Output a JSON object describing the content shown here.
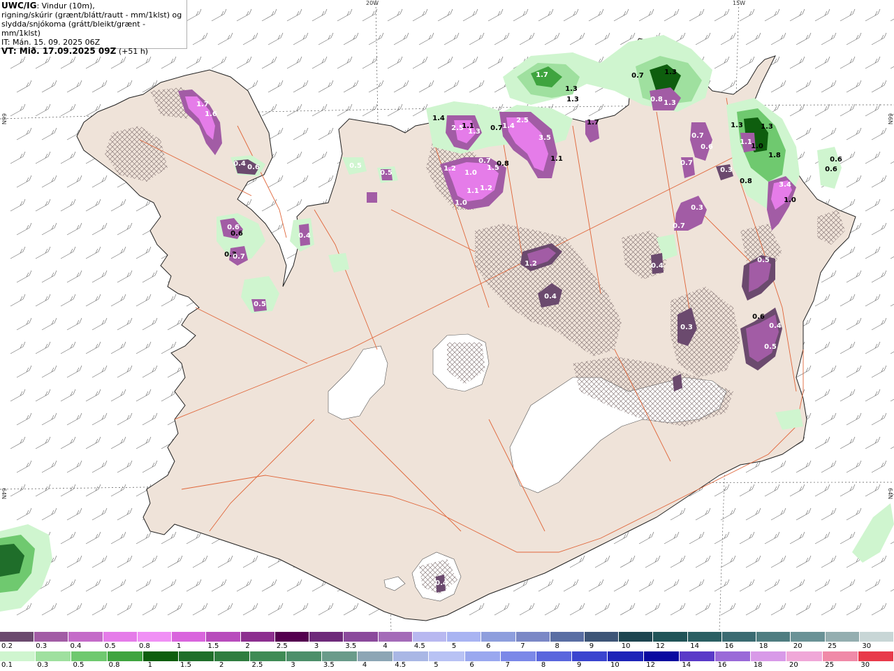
{
  "title": {
    "model": "UWC/IG",
    "desc_1": ": Vindur (10m),",
    "desc_2": "rigning/skúrir (grænt/blátt/rautt - mm/1klst) og",
    "desc_3": "slydda/snjókoma (grátt/bleikt/grænt - mm/1klst)",
    "it": "IT: Mán. 15. 09. 2025 06Z",
    "vt_label": "VT: Mið. 17.09.2025 09Z",
    "vt_offset": "(+51 h)"
  },
  "grid_labels": {
    "lon_20w": "20W",
    "lon_15w": "15W",
    "lat_66n_left": "66N",
    "lat_66n_right": "66N",
    "lat_64n_left": "64N",
    "lat_64n_right": "64N"
  },
  "value_labels": [
    {
      "t": "1.7",
      "c": "w"
    },
    {
      "t": "1.6",
      "c": "w"
    },
    {
      "t": "0.4",
      "c": "w"
    },
    {
      "t": "0.6",
      "c": "w"
    },
    {
      "t": "0.6",
      "c": "w"
    },
    {
      "t": "0.6",
      "c": "k"
    },
    {
      "t": "0.3",
      "c": "k"
    },
    {
      "t": "0.7",
      "c": "w"
    },
    {
      "t": "0.5",
      "c": "w"
    },
    {
      "t": "0.4",
      "c": "w"
    },
    {
      "t": "0.5",
      "c": "w"
    },
    {
      "t": "0.5",
      "c": "w"
    },
    {
      "t": "1.4",
      "c": "k"
    },
    {
      "t": "2.5",
      "c": "w"
    },
    {
      "t": "1.1",
      "c": "k"
    },
    {
      "t": "1.3",
      "c": "w"
    },
    {
      "t": "0.7",
      "c": "k"
    },
    {
      "t": "1.4",
      "c": "w"
    },
    {
      "t": "2.5",
      "c": "w"
    },
    {
      "t": "3.5",
      "c": "w"
    },
    {
      "t": "1.2",
      "c": "w"
    },
    {
      "t": "1.0",
      "c": "w"
    },
    {
      "t": "0.7",
      "c": "w"
    },
    {
      "t": "1.5",
      "c": "w"
    },
    {
      "t": "1.1",
      "c": "w"
    },
    {
      "t": "1.2",
      "c": "w"
    },
    {
      "t": "1.0",
      "c": "w"
    },
    {
      "t": "0.8",
      "c": "k"
    },
    {
      "t": "1.1",
      "c": "k"
    },
    {
      "t": "1.7",
      "c": "w"
    },
    {
      "t": "1.7",
      "c": "k"
    },
    {
      "t": "1.3",
      "c": "k"
    },
    {
      "t": "1.3",
      "c": "k"
    },
    {
      "t": "0.7",
      "c": "k"
    },
    {
      "t": "1.3",
      "c": "k"
    },
    {
      "t": "0.8",
      "c": "w"
    },
    {
      "t": "1.3",
      "c": "w"
    },
    {
      "t": "0.7",
      "c": "w"
    },
    {
      "t": "0.6",
      "c": "w"
    },
    {
      "t": "0.7",
      "c": "w"
    },
    {
      "t": "0.3",
      "c": "w"
    },
    {
      "t": "1.3",
      "c": "k"
    },
    {
      "t": "1.3",
      "c": "k"
    },
    {
      "t": "1.1",
      "c": "w"
    },
    {
      "t": "1.0",
      "c": "k"
    },
    {
      "t": "1.8",
      "c": "k"
    },
    {
      "t": "0.8",
      "c": "k"
    },
    {
      "t": "3.4",
      "c": "w"
    },
    {
      "t": "1.0",
      "c": "k"
    },
    {
      "t": "0.6",
      "c": "k"
    },
    {
      "t": "0.6",
      "c": "k"
    },
    {
      "t": "1.2",
      "c": "w"
    },
    {
      "t": "0.4",
      "c": "w"
    },
    {
      "t": "0.3",
      "c": "w"
    },
    {
      "t": "0.7",
      "c": "w"
    },
    {
      "t": "0.4",
      "c": "w"
    },
    {
      "t": "0.5",
      "c": "w"
    },
    {
      "t": "0.3",
      "c": "w"
    },
    {
      "t": "0.6",
      "c": "k"
    },
    {
      "t": "0.4",
      "c": "w"
    },
    {
      "t": "0.5",
      "c": "w"
    },
    {
      "t": "0.4",
      "c": "w"
    }
  ],
  "colorbar_snow": {
    "labels": [
      "0.2",
      "0.3",
      "0.4",
      "0.5",
      "0.8",
      "1",
      "1.5",
      "2",
      "2.5",
      "3",
      "3.5",
      "4",
      "4.5",
      "5",
      "6",
      "7",
      "8",
      "9",
      "10",
      "12",
      "14",
      "16",
      "18",
      "20",
      "25",
      "30"
    ],
    "colors": [
      "#6b4a6e",
      "#a25ca5",
      "#c46bc8",
      "#e57ce9",
      "#f090f5",
      "#d965dd",
      "#b84cbc",
      "#8d2f8f",
      "#54004f",
      "#6e2a7a",
      "#8b4a9c",
      "#a46bb8",
      "#b8b8f0",
      "#a9b4f2",
      "#8e9edd",
      "#7b88c6",
      "#5a6ea3",
      "#3e5577",
      "#1e4550",
      "#215458",
      "#2b5f63",
      "#3b6b72",
      "#4f7d81",
      "#6a9296",
      "#94aeb0",
      "#c8d6d6"
    ]
  },
  "colorbar_rain": {
    "labels": [
      "0.1",
      "0.3",
      "0.5",
      "0.8",
      "1",
      "1.5",
      "2",
      "2.5",
      "3",
      "3.5",
      "4",
      "4.5",
      "5",
      "6",
      "7",
      "8",
      "9",
      "10",
      "12",
      "14",
      "16",
      "18",
      "20",
      "25",
      "30"
    ],
    "colors": [
      "#cff5cf",
      "#9fe09f",
      "#6fc96f",
      "#3fa43f",
      "#0e5e0e",
      "#1f6e2a",
      "#2f7d3f",
      "#3f8b55",
      "#4d8f6a",
      "#6a9b8a",
      "#8da6b5",
      "#a9b7e5",
      "#b8c2f4",
      "#9aa8ef",
      "#7b88e8",
      "#5a66dd",
      "#3a44cf",
      "#1d24b8",
      "#0a0aa0",
      "#5a3ac8",
      "#9a6ad8",
      "#d89ae8",
      "#f0a8d8",
      "#f08aa8",
      "#e83a4a"
    ]
  }
}
